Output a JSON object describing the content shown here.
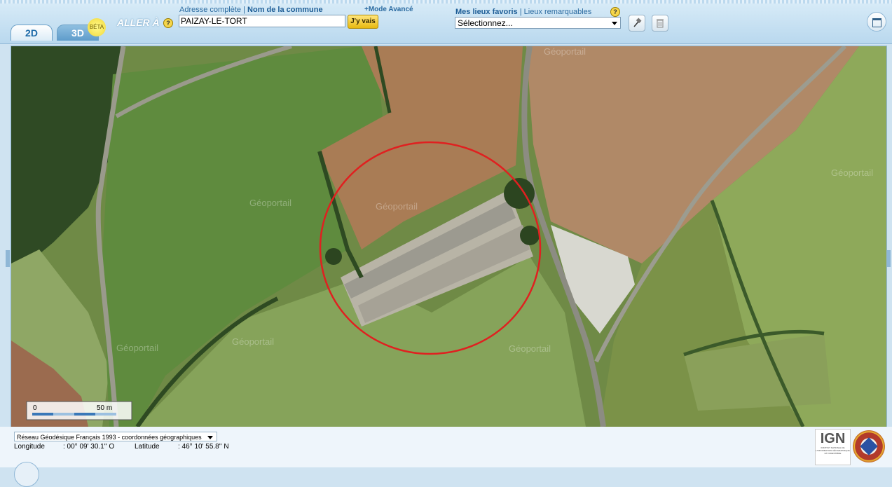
{
  "header": {
    "tabs": [
      {
        "label": "2D"
      },
      {
        "label": "3D"
      }
    ],
    "beta_label": "BÉTA",
    "goto_label": "ALLER À",
    "help_glyph": "?",
    "address_link": "Adresse complète",
    "separator": "|",
    "commune_link": "Nom de la commune",
    "advanced_link": "+Mode Avancé",
    "address_value": "PAIZAY-LE-TORT",
    "go_button": "J'y vais",
    "favorites_link": "Mes lieux favoris",
    "remarkable_link": "Lieux remarquables",
    "favorites_select": "Sélectionnez..."
  },
  "map": {
    "watermark": "Géoportail",
    "scale_min": "0",
    "scale_max": "50 m",
    "highlight_color": "#e02020"
  },
  "footer": {
    "projection": "Réseau Géodésique Français 1993 - coordonnées géographiques",
    "longitude_label": "Longitude",
    "longitude_value": ": 00° 09' 30.1'' O",
    "latitude_label": "Latitude",
    "latitude_value": ": 46° 10' 55.8'' N",
    "ign_logo_text": "IGN",
    "ign_subtext": "INSTITUT NATIONAL DE L'INFORMATION GÉOGRAPHIQUE ET FORESTIÈRE"
  },
  "icons": [
    "help-icon",
    "pin-icon",
    "trash-icon",
    "window-icon"
  ]
}
